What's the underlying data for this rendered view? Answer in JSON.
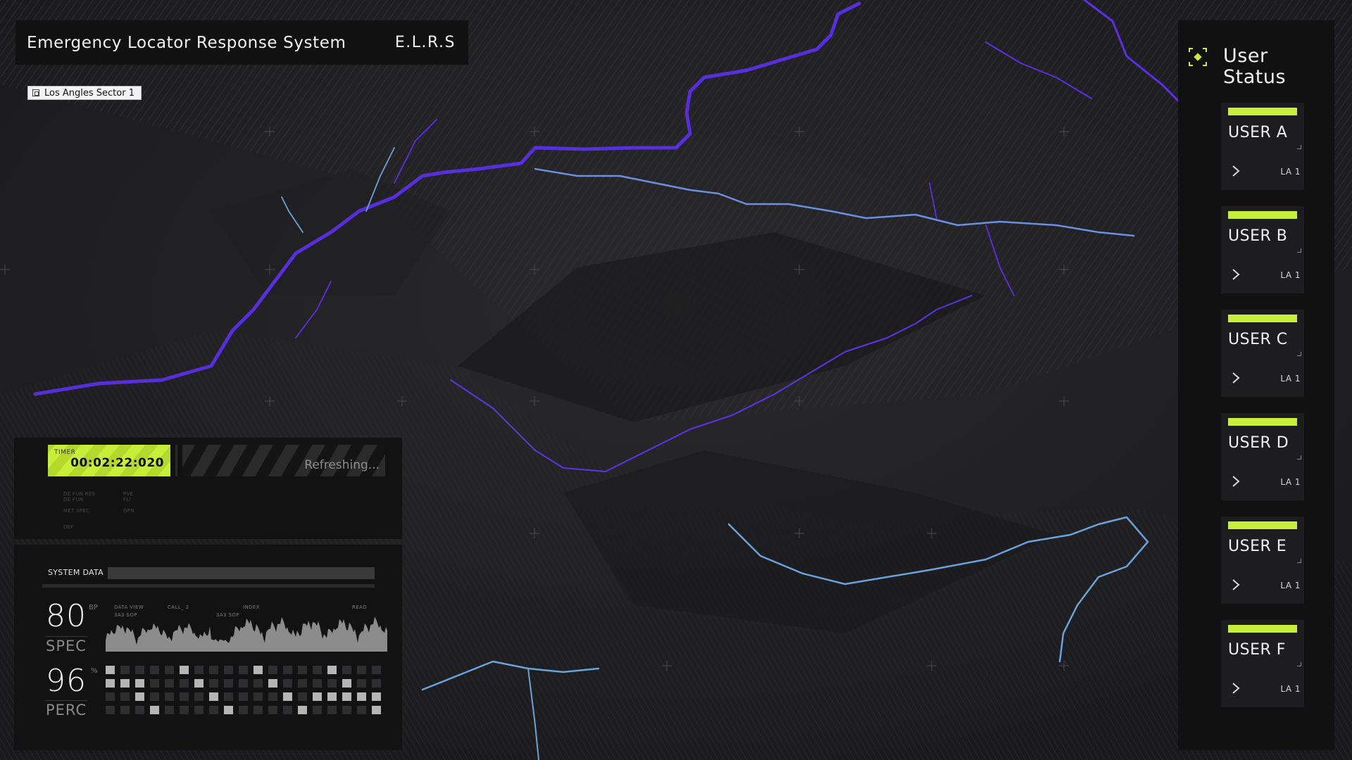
{
  "header": {
    "title": "Emergency Locator Response System",
    "abbr": "E.L.R.S"
  },
  "sector": {
    "label": "Los Angles Sector 1"
  },
  "timer": {
    "label": "TIMER",
    "value": "00:02:22:020",
    "status": "Refreshing..."
  },
  "timer_meta": [
    "DE FUN RES",
    "DE FUN",
    "MET SPEC",
    "DEF",
    "PVE",
    "FLI",
    "OPN"
  ],
  "system": {
    "title": "SYSTEM DATA",
    "metrics": [
      {
        "value": "80",
        "unit": "BP",
        "label": "SPEC"
      },
      {
        "value": "96",
        "unit": "%",
        "label": "PERC"
      }
    ],
    "chart_labels": [
      "DATA VIEW",
      "CALL_ 2",
      "INDEX",
      "READ",
      "3A3 SOP",
      "3A3 SOP"
    ]
  },
  "user_status": {
    "title_line1": "User",
    "title_line2": "Status",
    "users": [
      {
        "name": "USER A",
        "location": "LA 1"
      },
      {
        "name": "USER B",
        "location": "LA 1"
      },
      {
        "name": "USER C",
        "location": "LA 1"
      },
      {
        "name": "USER D",
        "location": "LA 1"
      },
      {
        "name": "USER E",
        "location": "LA 1"
      },
      {
        "name": "USER F",
        "location": "LA 1"
      }
    ]
  },
  "colors": {
    "accent": "#c6ee3a",
    "river_purple": "#5b2fe8",
    "river_blue": "#6aa8e8"
  }
}
